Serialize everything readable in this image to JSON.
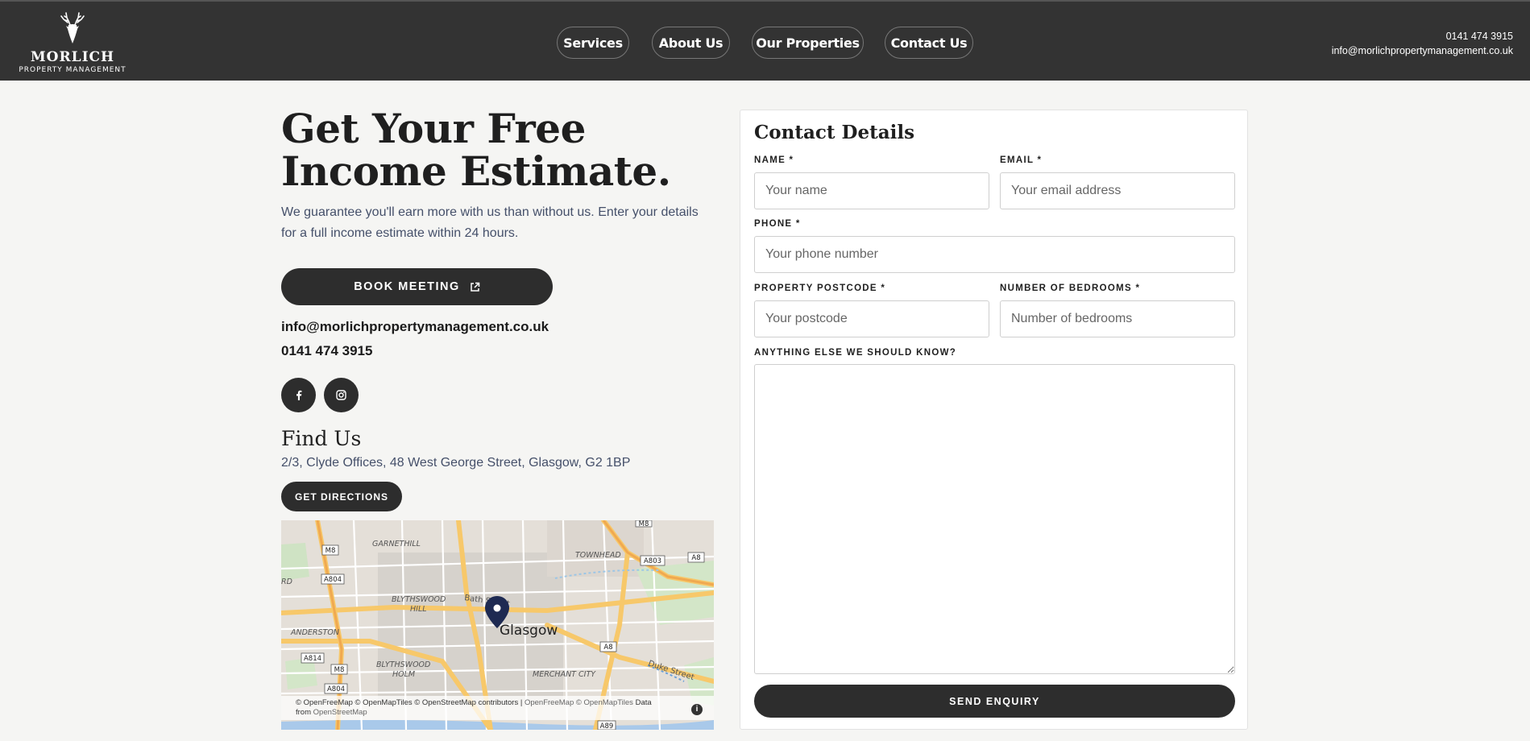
{
  "header": {
    "logo_title": "MORLICH",
    "logo_subtitle": "PROPERTY MANAGEMENT",
    "nav": [
      {
        "label": "Services"
      },
      {
        "label": "About Us"
      },
      {
        "label": "Our Properties"
      },
      {
        "label": "Contact Us"
      }
    ],
    "phone": "0141 474 3915",
    "email": "info@morlichpropertymanagement.co.uk"
  },
  "hero": {
    "title_line1": "Get Your Free",
    "title_line2": "Income Estimate.",
    "subtitle": "We guarantee you'll earn more with us than without us. Enter your details for a full income estimate within 24 hours.",
    "book_button": "BOOK MEETING",
    "email": "info@morlichpropertymanagement.co.uk",
    "phone": "0141 474 3915"
  },
  "social": [
    {
      "icon": "facebook-icon"
    },
    {
      "icon": "instagram-icon"
    }
  ],
  "find_us": {
    "title": "Find Us",
    "address": "2/3, Clyde Offices, 48 West George Street, Glasgow, G2 1BP",
    "directions_button": "GET DIRECTIONS"
  },
  "map": {
    "labels": {
      "garnethill": "GARNETHILL",
      "townhead": "TOWNHEAD",
      "blythswood_hill_1": "BLYTHSWOOD",
      "blythswood_hill_2": "HILL",
      "anderston": "ANDERSTON",
      "blythswood_holm_1": "BLYTHSWOOD",
      "blythswood_holm_2": "HOLM",
      "merchant_city": "MERCHANT CITY",
      "glasgow": "Glasgow",
      "bath_street": "Bath Street",
      "duke_street": "Duke Street",
      "rd": "RD"
    },
    "road_shields": {
      "m8_top": "M8",
      "m8_top_right": "M8",
      "a804_top": "A804",
      "a803": "A803",
      "a8_right": "A8",
      "a8_mid": "A8",
      "a814": "A814",
      "m8_bottom": "M8",
      "a804_bottom": "A804",
      "a89": "A89"
    },
    "attribution_1": "© OpenFreeMap © OpenMapTiles © OpenStreetMap contributors",
    "attribution_sep": " | ",
    "attribution_2": "OpenFreeMap © OpenMapTiles",
    "attribution_3": " Data",
    "attribution_4": "from ",
    "attribution_5": "OpenStreetMap",
    "info_glyph": "i"
  },
  "form": {
    "title": "Contact Details",
    "name_label": "NAME *",
    "name_placeholder": "Your name",
    "email_label": "EMAIL *",
    "email_placeholder": "Your email address",
    "phone_label": "PHONE *",
    "phone_placeholder": "Your phone number",
    "postcode_label": "PROPERTY POSTCODE *",
    "postcode_placeholder": "Your postcode",
    "bedrooms_label": "NUMBER OF BEDROOMS *",
    "bedrooms_placeholder": "Number of bedrooms",
    "notes_label": "ANYTHING ELSE WE SHOULD KNOW?",
    "submit": "SEND ENQUIRY"
  },
  "colors": {
    "header_bg": "#333333",
    "page_bg": "#f5f5f3",
    "button_dark": "#2d2d2d",
    "map_pin": "#1e2a52"
  }
}
